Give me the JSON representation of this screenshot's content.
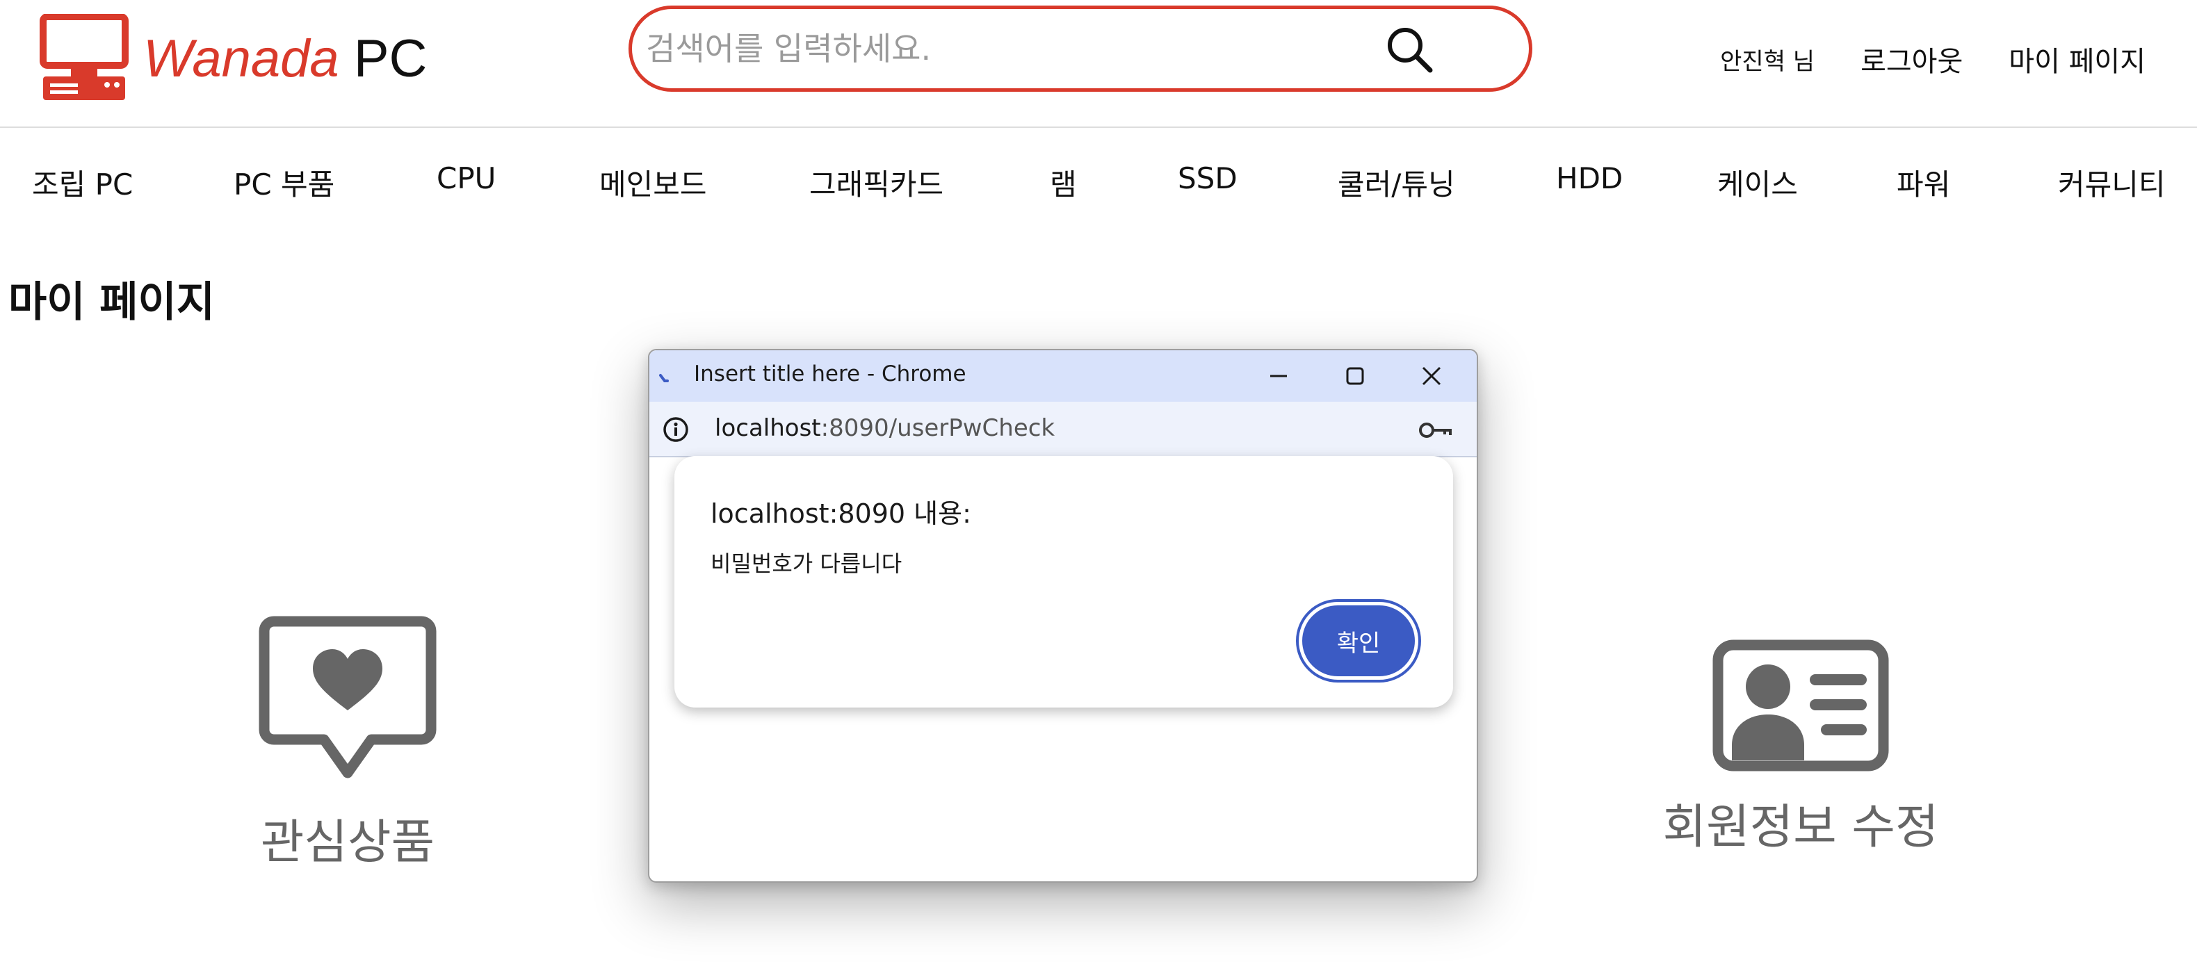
{
  "header": {
    "logo": {
      "brand": "Wanada",
      "suffix": "PC"
    },
    "search": {
      "placeholder": "검색어를 입력하세요."
    },
    "user": {
      "greeting": "안진혁 님",
      "logout": "로그아웃",
      "mypage": "마이 페이지"
    }
  },
  "nav": {
    "items": [
      "조립 PC",
      "PC 부품",
      "CPU",
      "메인보드",
      "그래픽카드",
      "램",
      "SSD",
      "쿨러/튜닝",
      "HDD",
      "케이스",
      "파워",
      "커뮤니티"
    ]
  },
  "page": {
    "title": "마이 페이지",
    "tiles": {
      "wishlist": "관심상품",
      "member_edit": "회원정보 수정"
    }
  },
  "popup": {
    "window_title": "Insert title here - Chrome",
    "url_host": "localhost",
    "url_rest": ":8090/userPwCheck",
    "dialog": {
      "title": "localhost:8090 내용:",
      "message": "비밀번호가 다릅니다",
      "ok_label": "확인"
    }
  },
  "colors": {
    "brand_red": "#d93a2b",
    "icon_gray": "#666666",
    "dialog_button": "#3b5bc4",
    "titlebar": "#d8e2fb"
  }
}
